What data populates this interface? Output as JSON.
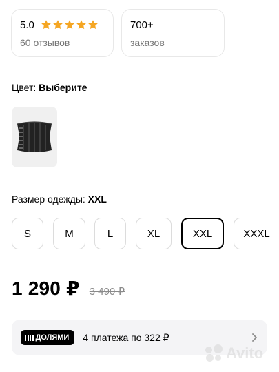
{
  "stats": {
    "rating": {
      "value": "5.0",
      "stars": 5,
      "label": "60 отзывов",
      "star_color": "#f5a623"
    },
    "orders": {
      "value": "700+",
      "label": "заказов"
    }
  },
  "color_section": {
    "label": "Цвет:",
    "value": "Выберите",
    "thumbnail_icon": "corset-image"
  },
  "size_section": {
    "label": "Размер одежды:",
    "value": "XXL",
    "options": [
      "S",
      "M",
      "L",
      "XL",
      "XXL",
      "XXXL"
    ],
    "selected": "XXL"
  },
  "price": {
    "current": "1 290 ₽",
    "old": "3 490 ₽"
  },
  "installments": {
    "badge": "ДОЛЯМИ",
    "text": "4 платежа по 322 ₽",
    "icon": "chevron-right-icon"
  },
  "watermark": {
    "text": "Avito"
  }
}
